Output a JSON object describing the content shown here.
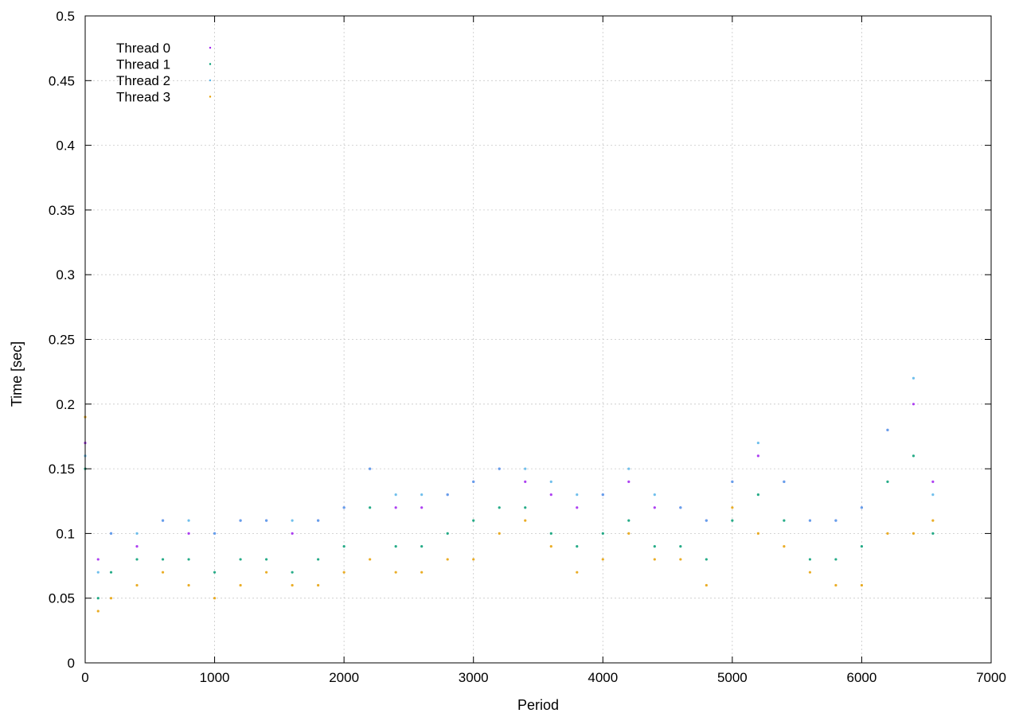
{
  "chart_data": {
    "type": "scatter",
    "title": "",
    "xlabel": "Period",
    "ylabel": "Time [sec]",
    "xlim": [
      0,
      7000
    ],
    "ylim": [
      0,
      0.5
    ],
    "x_ticks": [
      0,
      1000,
      2000,
      3000,
      4000,
      5000,
      6000,
      7000
    ],
    "y_ticks": [
      0,
      0.05,
      0.1,
      0.15,
      0.2,
      0.25,
      0.3,
      0.35,
      0.4,
      0.45,
      0.5
    ],
    "x_tick_labels": [
      "0",
      "1000",
      "2000",
      "3000",
      "4000",
      "5000",
      "6000",
      "7000"
    ],
    "y_tick_labels": [
      "0",
      "0.05",
      "0.1",
      "0.15",
      "0.2",
      "0.25",
      "0.3",
      "0.35",
      "0.4",
      "0.45",
      "0.5"
    ],
    "grid": true,
    "legend_position": "top-left",
    "series": [
      {
        "name": "Thread 0",
        "color": "#a020f0",
        "points": [
          [
            0,
            0.17
          ],
          [
            100,
            0.08
          ],
          [
            200,
            0.1
          ],
          [
            400,
            0.09
          ],
          [
            600,
            0.11
          ],
          [
            800,
            0.1
          ],
          [
            1000,
            0.1
          ],
          [
            1200,
            0.11
          ],
          [
            1400,
            0.11
          ],
          [
            1600,
            0.1
          ],
          [
            1800,
            0.11
          ],
          [
            2000,
            0.12
          ],
          [
            2200,
            0.15
          ],
          [
            2400,
            0.12
          ],
          [
            2600,
            0.12
          ],
          [
            2800,
            0.13
          ],
          [
            3000,
            0.14
          ],
          [
            3200,
            0.15
          ],
          [
            3400,
            0.14
          ],
          [
            3600,
            0.13
          ],
          [
            3800,
            0.12
          ],
          [
            4000,
            0.13
          ],
          [
            4200,
            0.14
          ],
          [
            4400,
            0.12
          ],
          [
            4600,
            0.12
          ],
          [
            4800,
            0.11
          ],
          [
            5000,
            0.14
          ],
          [
            5200,
            0.16
          ],
          [
            5400,
            0.14
          ],
          [
            5600,
            0.11
          ],
          [
            5800,
            0.11
          ],
          [
            6000,
            0.12
          ],
          [
            6200,
            0.18
          ],
          [
            6400,
            0.2
          ],
          [
            6550,
            0.14
          ]
        ]
      },
      {
        "name": "Thread 1",
        "color": "#009e73",
        "points": [
          [
            0,
            0.15
          ],
          [
            100,
            0.05
          ],
          [
            200,
            0.07
          ],
          [
            400,
            0.08
          ],
          [
            600,
            0.08
          ],
          [
            800,
            0.08
          ],
          [
            1000,
            0.07
          ],
          [
            1200,
            0.08
          ],
          [
            1400,
            0.08
          ],
          [
            1600,
            0.07
          ],
          [
            1800,
            0.08
          ],
          [
            2000,
            0.09
          ],
          [
            2200,
            0.12
          ],
          [
            2400,
            0.09
          ],
          [
            2600,
            0.09
          ],
          [
            2800,
            0.1
          ],
          [
            3000,
            0.11
          ],
          [
            3200,
            0.12
          ],
          [
            3400,
            0.12
          ],
          [
            3600,
            0.1
          ],
          [
            3800,
            0.09
          ],
          [
            4000,
            0.1
          ],
          [
            4200,
            0.11
          ],
          [
            4400,
            0.09
          ],
          [
            4600,
            0.09
          ],
          [
            4800,
            0.08
          ],
          [
            5000,
            0.11
          ],
          [
            5200,
            0.13
          ],
          [
            5400,
            0.11
          ],
          [
            5600,
            0.08
          ],
          [
            5800,
            0.08
          ],
          [
            6000,
            0.09
          ],
          [
            6200,
            0.14
          ],
          [
            6400,
            0.16
          ],
          [
            6550,
            0.1
          ]
        ]
      },
      {
        "name": "Thread 2",
        "color": "#56b4e9",
        "points": [
          [
            0,
            0.16
          ],
          [
            100,
            0.07
          ],
          [
            200,
            0.1
          ],
          [
            400,
            0.1
          ],
          [
            600,
            0.11
          ],
          [
            800,
            0.11
          ],
          [
            1000,
            0.1
          ],
          [
            1200,
            0.11
          ],
          [
            1400,
            0.11
          ],
          [
            1600,
            0.11
          ],
          [
            1800,
            0.11
          ],
          [
            2000,
            0.12
          ],
          [
            2200,
            0.15
          ],
          [
            2400,
            0.13
          ],
          [
            2600,
            0.13
          ],
          [
            2800,
            0.13
          ],
          [
            3000,
            0.14
          ],
          [
            3200,
            0.15
          ],
          [
            3400,
            0.15
          ],
          [
            3600,
            0.14
          ],
          [
            3800,
            0.13
          ],
          [
            4000,
            0.13
          ],
          [
            4200,
            0.15
          ],
          [
            4400,
            0.13
          ],
          [
            4600,
            0.12
          ],
          [
            4800,
            0.11
          ],
          [
            5000,
            0.14
          ],
          [
            5200,
            0.17
          ],
          [
            5400,
            0.14
          ],
          [
            5600,
            0.11
          ],
          [
            5800,
            0.11
          ],
          [
            6000,
            0.12
          ],
          [
            6200,
            0.18
          ],
          [
            6400,
            0.22
          ],
          [
            6550,
            0.13
          ]
        ]
      },
      {
        "name": "Thread 3",
        "color": "#e69f00",
        "points": [
          [
            0,
            0.19
          ],
          [
            100,
            0.04
          ],
          [
            200,
            0.05
          ],
          [
            400,
            0.06
          ],
          [
            600,
            0.07
          ],
          [
            800,
            0.06
          ],
          [
            1000,
            0.05
          ],
          [
            1200,
            0.06
          ],
          [
            1400,
            0.07
          ],
          [
            1600,
            0.06
          ],
          [
            1800,
            0.06
          ],
          [
            2000,
            0.07
          ],
          [
            2200,
            0.08
          ],
          [
            2400,
            0.07
          ],
          [
            2600,
            0.07
          ],
          [
            2800,
            0.08
          ],
          [
            3000,
            0.08
          ],
          [
            3200,
            0.1
          ],
          [
            3400,
            0.11
          ],
          [
            3600,
            0.09
          ],
          [
            3800,
            0.07
          ],
          [
            4000,
            0.08
          ],
          [
            4200,
            0.1
          ],
          [
            4400,
            0.08
          ],
          [
            4600,
            0.08
          ],
          [
            4800,
            0.06
          ],
          [
            5000,
            0.12
          ],
          [
            5200,
            0.1
          ],
          [
            5400,
            0.09
          ],
          [
            5600,
            0.07
          ],
          [
            5800,
            0.06
          ],
          [
            6000,
            0.06
          ],
          [
            6200,
            0.1
          ],
          [
            6400,
            0.1
          ],
          [
            6550,
            0.11
          ]
        ]
      }
    ]
  }
}
